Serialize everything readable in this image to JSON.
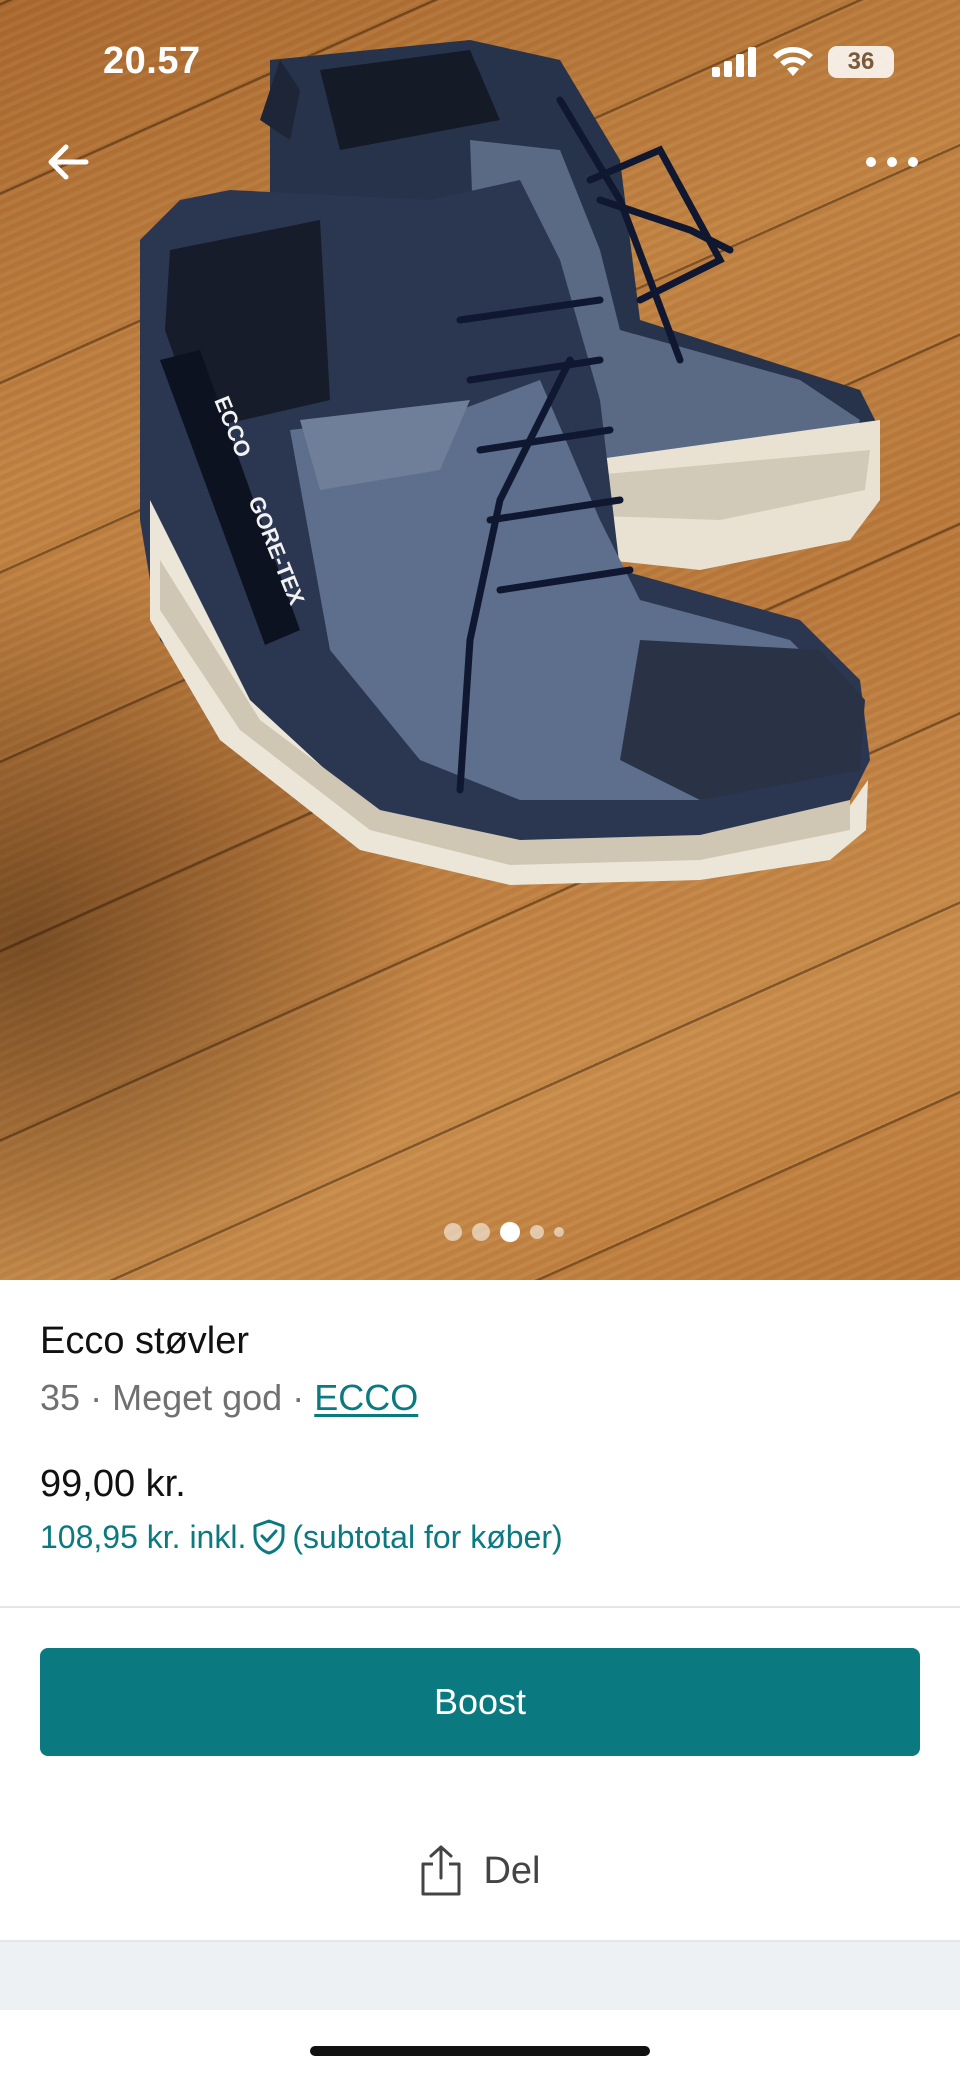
{
  "status_bar": {
    "time": "20.57",
    "battery": "36"
  },
  "photo": {
    "icons": [
      "back-arrow-icon",
      "more-icon"
    ],
    "carousel": {
      "count": 5,
      "active_index": 2
    }
  },
  "item": {
    "title": "Ecco støvler",
    "size": "35",
    "separator": "·",
    "condition": "Meget god",
    "brand": "ECCO",
    "price": "99,00 kr.",
    "price_incl": "108,95 kr. inkl.",
    "price_incl_note": "(subtotal for køber)"
  },
  "actions": {
    "boost_label": "Boost",
    "share_label": "Del"
  },
  "colors": {
    "accent": "#0b7a80",
    "muted_text": "#707070",
    "footer_band": "#eef1f3"
  }
}
